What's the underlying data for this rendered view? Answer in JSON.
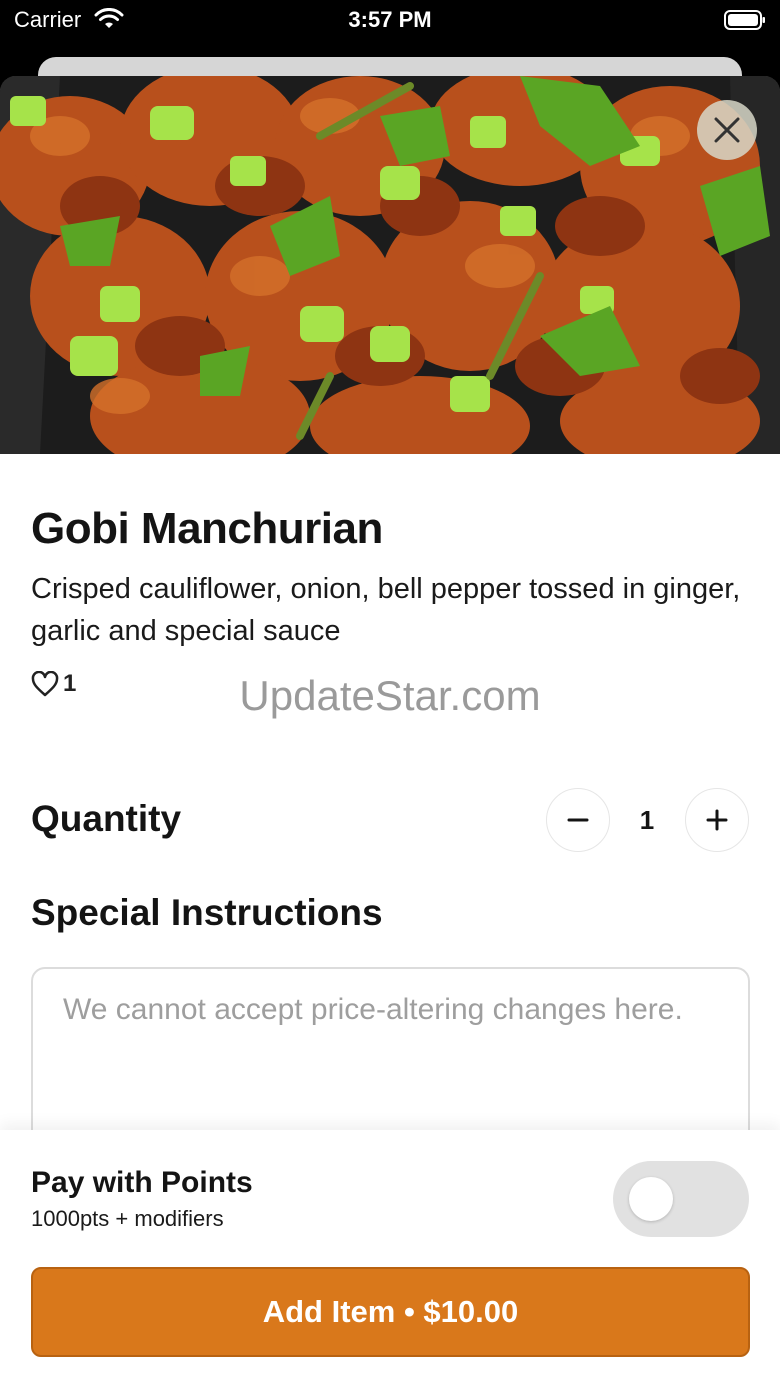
{
  "status_bar": {
    "carrier": "Carrier",
    "time": "3:57 PM",
    "icons": [
      "wifi-icon",
      "battery-icon"
    ]
  },
  "hero": {
    "icon": "food-photo",
    "close_icon": "close-icon"
  },
  "item": {
    "title": "Gobi Manchurian",
    "description": "Crisped cauliflower, onion, bell pepper tossed in ginger, garlic and special sauce",
    "likes_count": "1",
    "like_icon": "heart-icon"
  },
  "watermark": "UpdateStar.com",
  "quantity": {
    "label": "Quantity",
    "value": "1",
    "decrement_icon": "minus-icon",
    "increment_icon": "plus-icon"
  },
  "instructions": {
    "label": "Special Instructions",
    "placeholder": "We cannot accept price-altering changes here.",
    "value": ""
  },
  "points": {
    "title": "Pay with Points",
    "subtitle": "1000pts + modifiers",
    "enabled": false
  },
  "add_button": {
    "label": "Add Item • $10.00"
  },
  "colors": {
    "accent": "#d9781b",
    "toggle_off": "#e1e1e1"
  }
}
